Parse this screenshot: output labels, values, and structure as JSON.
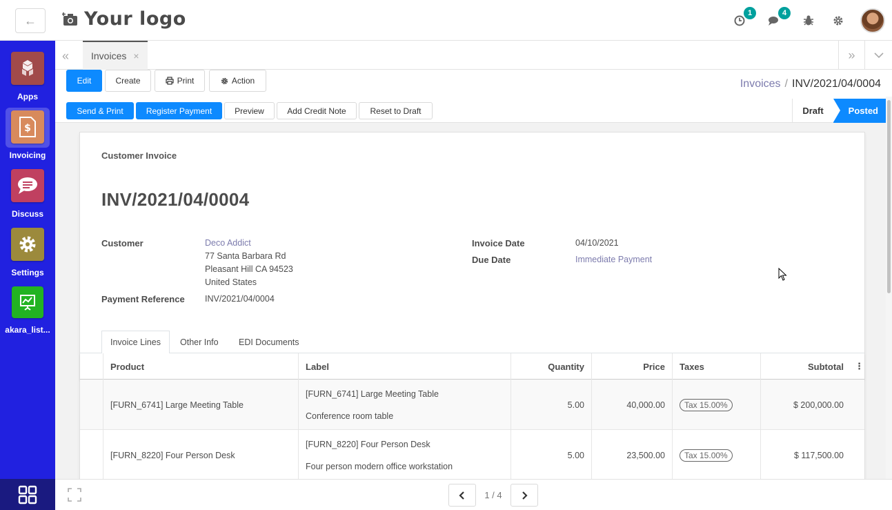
{
  "topbar": {
    "logo_text": "Your logo",
    "activity_badge": "1",
    "messages_badge": "4"
  },
  "sidebar": {
    "apps": [
      {
        "label": "Apps",
        "icon": "cubes-icon",
        "color": "#a14a4a"
      },
      {
        "label": "Invoicing",
        "icon": "invoice-icon",
        "color": "#d88a5c"
      },
      {
        "label": "Discuss",
        "icon": "chat-icon",
        "color": "#c04060"
      },
      {
        "label": "Settings",
        "icon": "gear-icon",
        "color": "#9c8a3c"
      },
      {
        "label": "akara_list...",
        "icon": "presentation-icon",
        "color": "#22b322"
      }
    ]
  },
  "tabs": {
    "doc_tab": "Invoices"
  },
  "control": {
    "edit": "Edit",
    "create": "Create",
    "print": "Print",
    "action": "Action",
    "breadcrumb_parent": "Invoices",
    "breadcrumb_sep": "/",
    "breadcrumb_current": "INV/2021/04/0004"
  },
  "status": {
    "send_print": "Send & Print",
    "register_payment": "Register Payment",
    "preview": "Preview",
    "add_credit_note": "Add Credit Note",
    "reset_to_draft": "Reset to Draft",
    "stage_draft": "Draft",
    "stage_posted": "Posted"
  },
  "invoice": {
    "subtitle": "Customer Invoice",
    "number": "INV/2021/04/0004",
    "customer_label": "Customer",
    "customer_name": "Deco Addict",
    "address_line1": "77 Santa Barbara Rd",
    "address_line2": "Pleasant Hill CA 94523",
    "address_line3": "United States",
    "payment_ref_label": "Payment Reference",
    "payment_ref": "INV/2021/04/0004",
    "invoice_date_label": "Invoice Date",
    "invoice_date": "04/10/2021",
    "due_date_label": "Due Date",
    "due_date": "Immediate Payment"
  },
  "notebook": {
    "tabs": [
      "Invoice Lines",
      "Other Info",
      "EDI Documents"
    ]
  },
  "lines": {
    "headers": {
      "product": "Product",
      "label": "Label",
      "quantity": "Quantity",
      "price": "Price",
      "taxes": "Taxes",
      "subtotal": "Subtotal"
    },
    "rows": [
      {
        "product": "[FURN_6741] Large Meeting Table",
        "label_1": "[FURN_6741] Large Meeting Table",
        "label_2": "Conference room table",
        "quantity": "5.00",
        "price": "40,000.00",
        "tax": "Tax 15.00%",
        "subtotal": "$ 200,000.00"
      },
      {
        "product": "[FURN_8220] Four Person Desk",
        "label_1": "[FURN_8220] Four Person Desk",
        "label_2": "Four person modern office workstation",
        "quantity": "5.00",
        "price": "23,500.00",
        "tax": "Tax 15.00%",
        "subtotal": "$ 117,500.00"
      }
    ]
  },
  "pager": {
    "value": "1 / 4"
  }
}
